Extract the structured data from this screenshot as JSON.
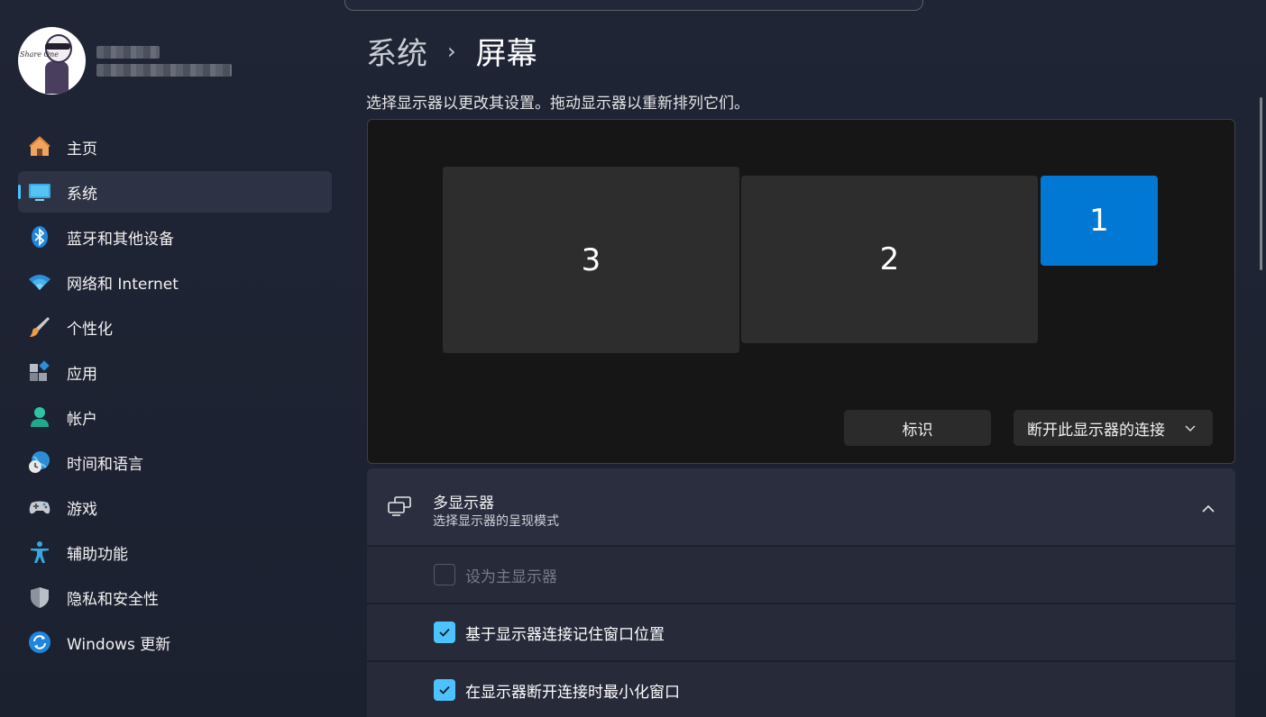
{
  "sidebar": {
    "profile": {
      "avatar_text": "Share One"
    },
    "items": [
      {
        "label": "主页",
        "icon": "home-icon"
      },
      {
        "label": "系统",
        "icon": "monitor-icon",
        "active": true
      },
      {
        "label": "蓝牙和其他设备",
        "icon": "bluetooth-icon"
      },
      {
        "label": "网络和 Internet",
        "icon": "wifi-icon"
      },
      {
        "label": "个性化",
        "icon": "brush-icon"
      },
      {
        "label": "应用",
        "icon": "apps-icon"
      },
      {
        "label": "帐户",
        "icon": "account-icon"
      },
      {
        "label": "时间和语言",
        "icon": "globe-clock-icon"
      },
      {
        "label": "游戏",
        "icon": "gamepad-icon"
      },
      {
        "label": "辅助功能",
        "icon": "accessibility-icon"
      },
      {
        "label": "隐私和安全性",
        "icon": "shield-icon"
      },
      {
        "label": "Windows 更新",
        "icon": "update-icon"
      }
    ]
  },
  "header": {
    "breadcrumb_parent": "系统",
    "breadcrumb_sep": "›",
    "breadcrumb_current": "屏幕"
  },
  "display": {
    "instruction": "选择显示器以更改其设置。拖动显示器以重新排列它们。",
    "monitors": [
      {
        "number": "3"
      },
      {
        "number": "2"
      },
      {
        "number": "1",
        "selected": true
      }
    ],
    "identify_label": "标识",
    "disconnect_label": "断开此显示器的连接"
  },
  "multi_display": {
    "title": "多显示器",
    "subtitle": "选择显示器的呈现模式",
    "options": [
      {
        "label": "设为主显示器",
        "checked": false,
        "disabled": true
      },
      {
        "label": "基于显示器连接记住窗口位置",
        "checked": true,
        "disabled": false
      },
      {
        "label": "在显示器断开连接时最小化窗口",
        "checked": true,
        "disabled": false
      }
    ]
  },
  "colors": {
    "accent": "#4cc2ff",
    "selected_monitor": "#0078d4",
    "background": "#1c2230"
  }
}
